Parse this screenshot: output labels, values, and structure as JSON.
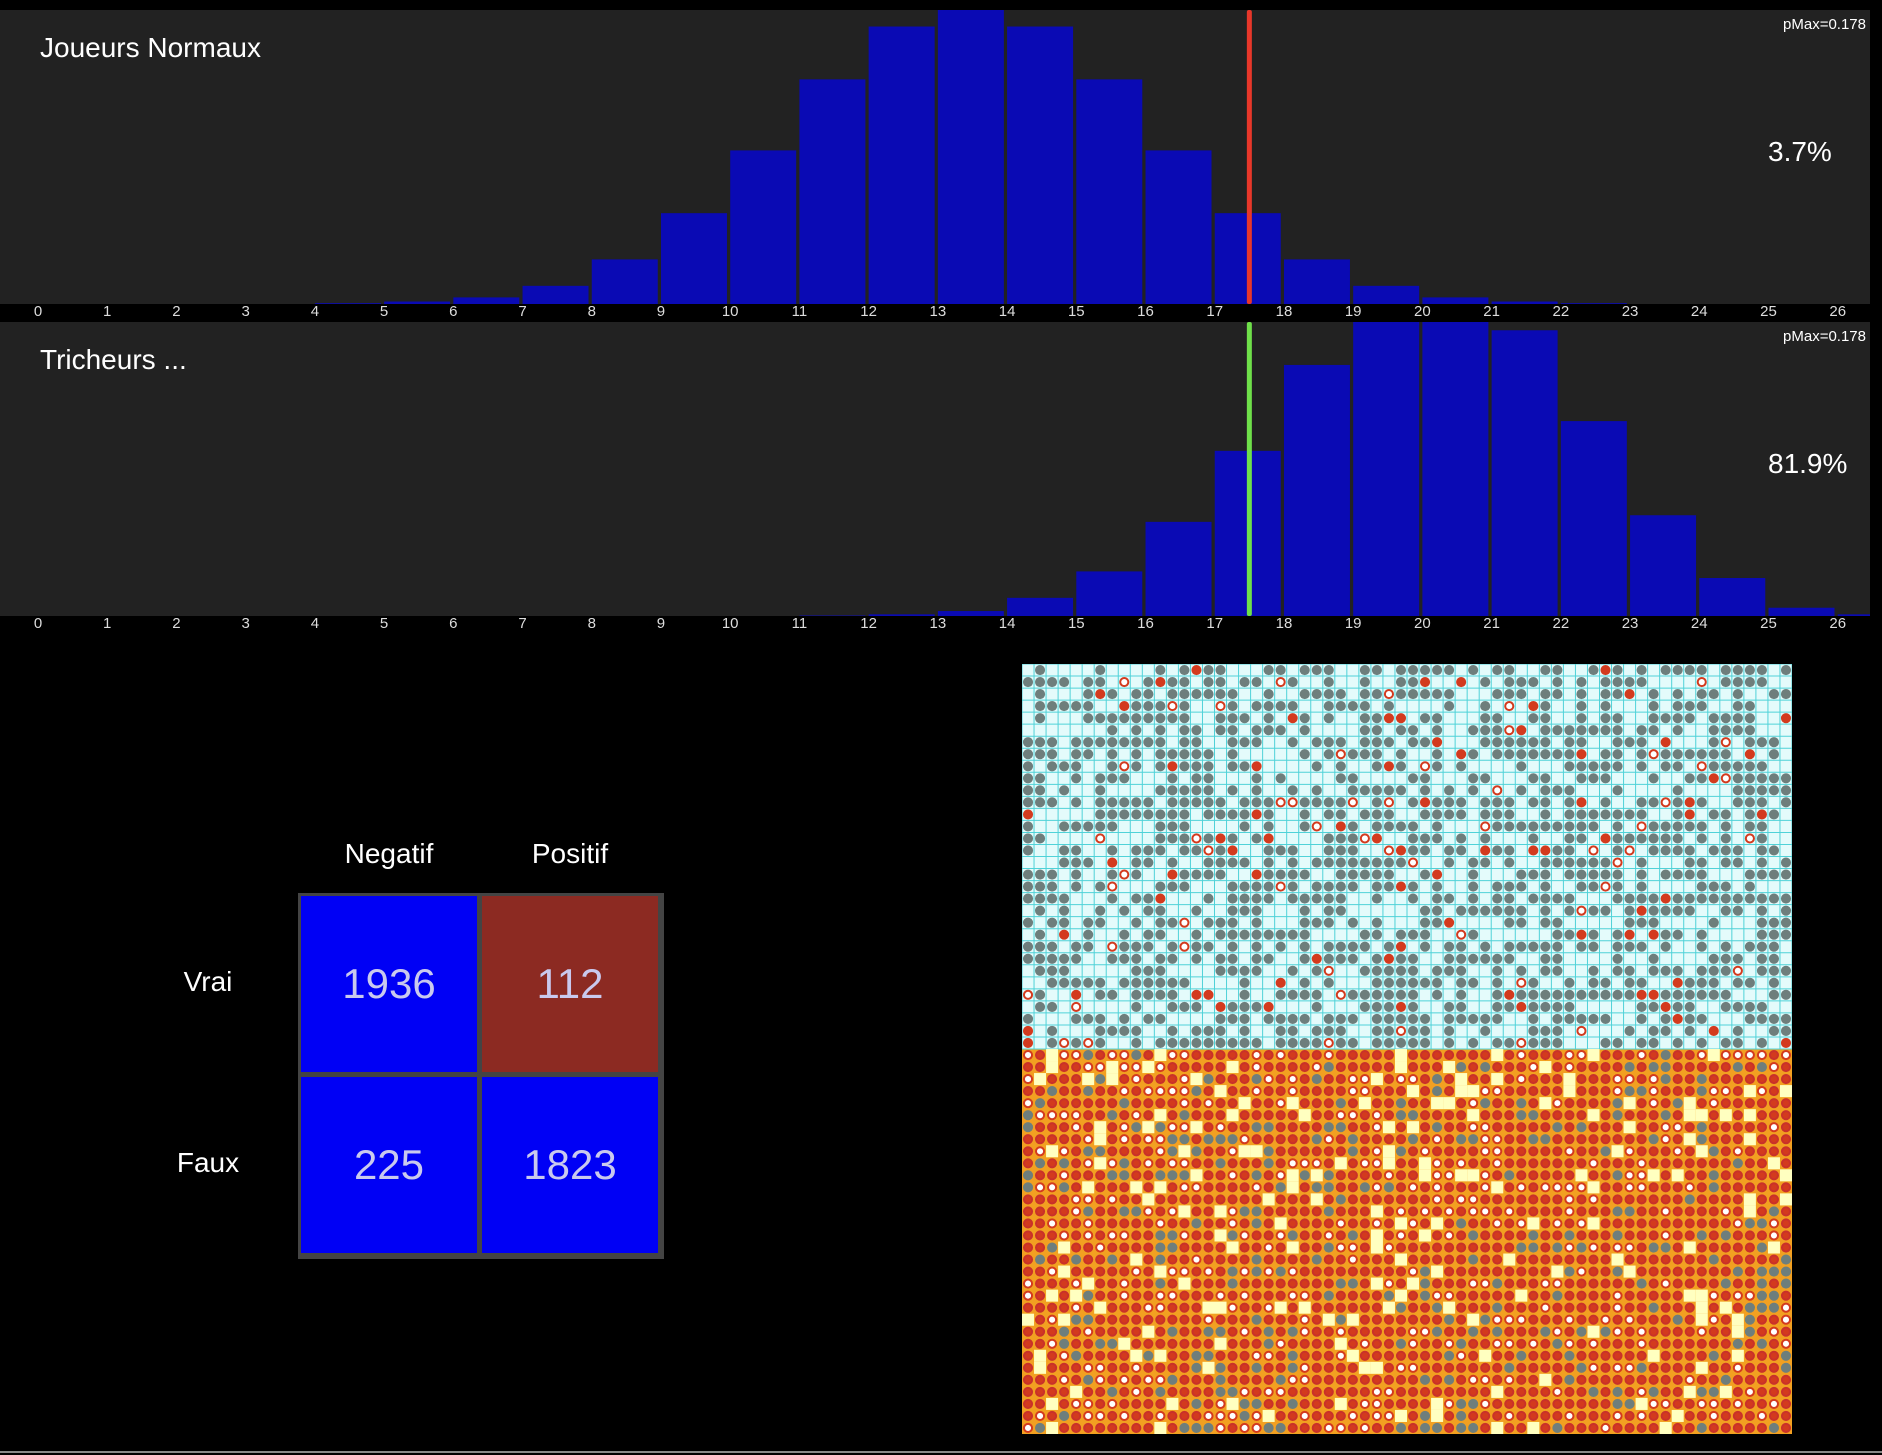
{
  "chart_data": [
    {
      "type": "bar",
      "title": "Joueurs Normaux",
      "annotation_pmax": "pMax=0.178",
      "annotation_percent": "3.7%",
      "categories": [
        "0",
        "1",
        "2",
        "3",
        "4",
        "5",
        "6",
        "7",
        "8",
        "9",
        "10",
        "11",
        "12",
        "13",
        "14",
        "15",
        "16",
        "17",
        "18",
        "19",
        "20",
        "21",
        "22",
        "23",
        "24",
        "25",
        "26"
      ],
      "values": [
        0,
        0,
        0,
        0,
        0.0005,
        0.0015,
        0.004,
        0.011,
        0.027,
        0.055,
        0.093,
        0.136,
        0.168,
        0.178,
        0.168,
        0.136,
        0.093,
        0.055,
        0.027,
        0.011,
        0.004,
        0.0015,
        0.0005,
        0,
        0,
        0,
        0
      ],
      "ylim": [
        0,
        0.178
      ],
      "threshold": 17.5,
      "threshold_color": "#e8372a",
      "bar_color": "#0a0ab4"
    },
    {
      "type": "bar",
      "title": "Tricheurs ...",
      "annotation_pmax": "pMax=0.178",
      "annotation_percent": "81.9%",
      "categories": [
        "0",
        "1",
        "2",
        "3",
        "4",
        "5",
        "6",
        "7",
        "8",
        "9",
        "10",
        "11",
        "12",
        "13",
        "14",
        "15",
        "16",
        "17",
        "18",
        "19",
        "20",
        "21",
        "22",
        "23",
        "24",
        "25",
        "26"
      ],
      "values": [
        0,
        0,
        0,
        0,
        0,
        0,
        0,
        0,
        0,
        0,
        0,
        0.0003,
        0.001,
        0.003,
        0.011,
        0.027,
        0.057,
        0.1,
        0.152,
        0.19,
        0.206,
        0.173,
        0.118,
        0.061,
        0.023,
        0.005,
        0.001
      ],
      "ylim": [
        0,
        0.178
      ],
      "threshold": 17.5,
      "threshold_color": "#6fe04a",
      "bar_color": "#0a0ab4"
    },
    {
      "type": "table",
      "col_labels": [
        "Negatif",
        "Positif"
      ],
      "row_labels": [
        "Vrai",
        "Faux"
      ],
      "cells": [
        [
          {
            "value": "1936",
            "color": "#0000f5"
          },
          {
            "value": "112",
            "color": "#8c2a22"
          }
        ],
        [
          {
            "value": "225",
            "color": "#0000f5"
          },
          {
            "value": "1823",
            "color": "#0000f5"
          }
        ]
      ]
    }
  ],
  "colors": {
    "background": "#000000",
    "panel": "#222222",
    "bar": "#0a0ab4",
    "mosaic_top": "#e4fbfb",
    "mosaic_top_grid": "#4fd2d8",
    "mosaic_bottom": "#f2a021",
    "mosaic_gray_dot": "#6e7e7c",
    "mosaic_red": "#d33a1e",
    "mosaic_yellow": "#ffffc0"
  },
  "mosaic": {
    "columns": 64,
    "rows_per_half": 32
  }
}
